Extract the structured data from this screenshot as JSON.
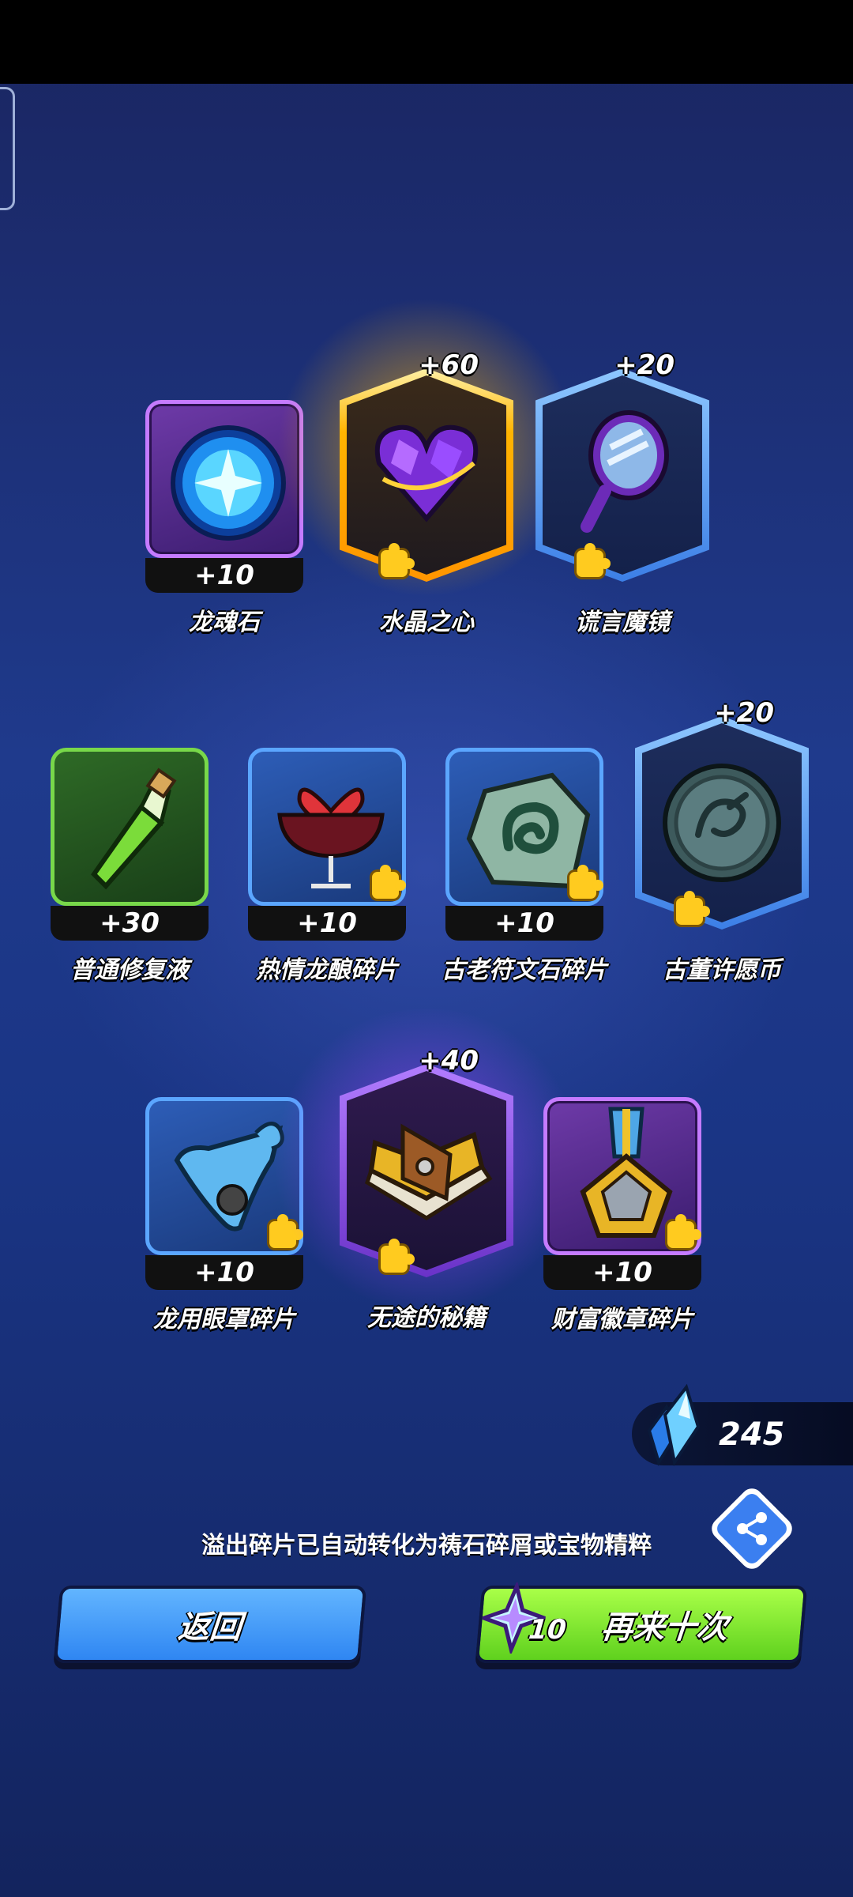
{
  "rewards": [
    {
      "name": "龙魂石",
      "qty": "+10"
    },
    {
      "name": "水晶之心",
      "qty": "+60"
    },
    {
      "name": "谎言魔镜",
      "qty": "+20"
    },
    {
      "name": "普通修复液",
      "qty": "+30"
    },
    {
      "name": "热情龙酿碎片",
      "qty": "+10"
    },
    {
      "name": "古老符文石碎片",
      "qty": "+10"
    },
    {
      "name": "古董许愿币",
      "qty": "+20"
    },
    {
      "name": "龙用眼罩碎片",
      "qty": "+10"
    },
    {
      "name": "无途的秘籍",
      "qty": "+40"
    },
    {
      "name": "财富徽章碎片",
      "qty": "+10"
    }
  ],
  "currency": {
    "icon": "blue-crystal-icon",
    "value": "245"
  },
  "notice": "溢出碎片已自动转化为祷石碎屑或宝物精粹",
  "buttons": {
    "back": "返回",
    "again": "再来十次",
    "again_cost": "10",
    "again_cost_icon": "star-crystal-icon"
  },
  "share_icon": "share-icon"
}
